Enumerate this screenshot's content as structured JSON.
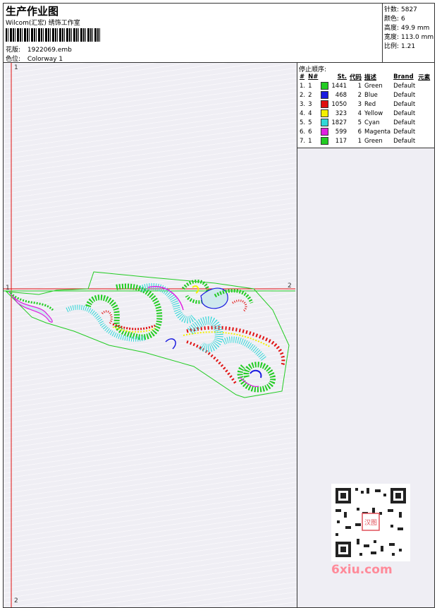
{
  "header": {
    "title": "生产作业图",
    "company": "Wilcom(汇宏) 绣饰工作室",
    "design_label": "花版:",
    "design_value": "1922069.emb",
    "colorway_label": "色位:",
    "colorway_value": "Colorway 1"
  },
  "info": {
    "stitches_label": "针数:",
    "stitches_value": "5827",
    "colors_label": "颜色:",
    "colors_value": "6",
    "height_label": "高度:",
    "height_value": "49.9 mm",
    "width_label": "宽度:",
    "width_value": "113.0 mm",
    "scale_label": "比例:",
    "scale_value": "1.21"
  },
  "stop_sequence": {
    "title": "停止顺序:",
    "columns": [
      "#",
      "N#",
      "St.",
      "代码",
      "描述",
      "Brand",
      "元素"
    ],
    "rows": [
      {
        "idx": "1.",
        "n": "1",
        "color": "#22cc22",
        "st": "1441",
        "code": "1",
        "desc": "Green",
        "brand": "Default"
      },
      {
        "idx": "2.",
        "n": "2",
        "color": "#1a1adf",
        "st": "468",
        "code": "2",
        "desc": "Blue",
        "brand": "Default"
      },
      {
        "idx": "3.",
        "n": "3",
        "color": "#e01010",
        "st": "1050",
        "code": "3",
        "desc": "Red",
        "brand": "Default"
      },
      {
        "idx": "4.",
        "n": "4",
        "color": "#f5f000",
        "st": "323",
        "code": "4",
        "desc": "Yellow",
        "brand": "Default"
      },
      {
        "idx": "5.",
        "n": "5",
        "color": "#30d8d8",
        "st": "1827",
        "code": "5",
        "desc": "Cyan",
        "brand": "Default"
      },
      {
        "idx": "6.",
        "n": "6",
        "color": "#e020e0",
        "st": "599",
        "code": "6",
        "desc": "Magenta",
        "brand": "Default"
      },
      {
        "idx": "7.",
        "n": "1",
        "color": "#22cc22",
        "st": "117",
        "code": "1",
        "desc": "Green",
        "brand": "Default"
      }
    ]
  },
  "markers": {
    "one_top": "1",
    "one_left": "1",
    "two_right": "2",
    "two_bottom": "2"
  },
  "watermark": {
    "site": "6xiu.com",
    "seal_text": "汉图"
  },
  "colors": {
    "needle_line": "#e01010",
    "outline": "#22cc22"
  }
}
